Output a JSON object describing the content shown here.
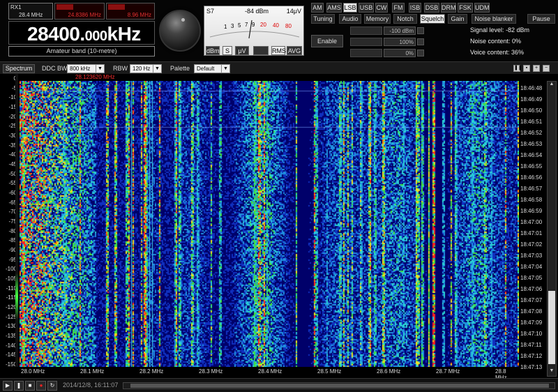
{
  "receiver": {
    "rx_label": "RX1",
    "rx_freq": "28.4 MHz",
    "red_readout_1": "24.8386 MHz",
    "red_readout_2": "8.96 MHz",
    "freq_main": "28400.",
    "freq_small": "000",
    "freq_unit": "kHz",
    "band": "Amateur band (10-metre)"
  },
  "smeter": {
    "s_value": "S7",
    "dbm_value": "-84 dBm",
    "uv_value": "14μV",
    "scale_labels": [
      "1",
      "3",
      "5",
      "7",
      "9",
      "20",
      "40",
      "80"
    ],
    "buttons": [
      "dBm",
      "S",
      "μV",
      "RMS",
      "AVG"
    ],
    "active_button": "S"
  },
  "modes": {
    "items": [
      "AM",
      "AMS",
      "LSB",
      "USB",
      "CW",
      "FM",
      "ISB",
      "DSB",
      "DRM",
      "FSK",
      "UDM"
    ],
    "active": "LSB"
  },
  "tabs": {
    "items": [
      "Tuning",
      "Audio",
      "Memory",
      "Notch",
      "Squelch",
      "Gain",
      "Noise blanker",
      "Pause"
    ],
    "active": "Squelch"
  },
  "squelch": {
    "enable_label": "Enable",
    "rows": [
      {
        "value": "-100 dBm",
        "label": "Signal level: -82 dBm"
      },
      {
        "value": "100%",
        "label": "Noise content: 0%"
      },
      {
        "value": "0%",
        "label": "Voice content: 36%"
      }
    ]
  },
  "toolbar": {
    "spectrum_label": "Spectrum",
    "ddc_bw_label": "DDC BW",
    "ddc_bw_value": "800 kHz",
    "rbw_label": "RBW",
    "rbw_value": "120 Hz",
    "palette_label": "Palette",
    "palette_value": "Default",
    "marker_freq": "28.123620 MHz"
  },
  "waterfall": {
    "y_ticks": [
      "0",
      "-5",
      "-10",
      "-15",
      "-20",
      "-25",
      "-30",
      "-35",
      "-40",
      "-45",
      "-50",
      "-55",
      "-60",
      "-65",
      "-70",
      "-75",
      "-80",
      "-85",
      "-90",
      "-95",
      "-100",
      "-105",
      "-110",
      "-115",
      "-120",
      "-125",
      "-130",
      "-135",
      "-140",
      "-145",
      "-150"
    ],
    "x_ticks": [
      "28.0 MHz",
      "28.1 MHz",
      "28.2 MHz",
      "28.3 MHz",
      "28.4 MHz",
      "28.5 MHz",
      "28.6 MHz",
      "28.7 MHz",
      "28.8 MHz"
    ],
    "time_ticks": [
      "18:46:48",
      "18:46:49",
      "18:46:50",
      "18:46:51",
      "18:46:52",
      "18:46:53",
      "18:46:54",
      "18:46:55",
      "18:46:56",
      "18:46:57",
      "18:46:58",
      "18:46:59",
      "18:47:00",
      "18:47:01",
      "18:47:02",
      "18:47:03",
      "18:47:04",
      "18:47:05",
      "18:47:06",
      "18:47:07",
      "18:47:08",
      "18:47:09",
      "18:47:10",
      "18:47:11",
      "18:47:12",
      "18:47:13"
    ],
    "colors": {
      "low": "#00008b",
      "mid": "#2ad4d4",
      "high": "#ff2020"
    }
  },
  "transport": {
    "timestamp": "2014/12/8, 16:11:07"
  }
}
